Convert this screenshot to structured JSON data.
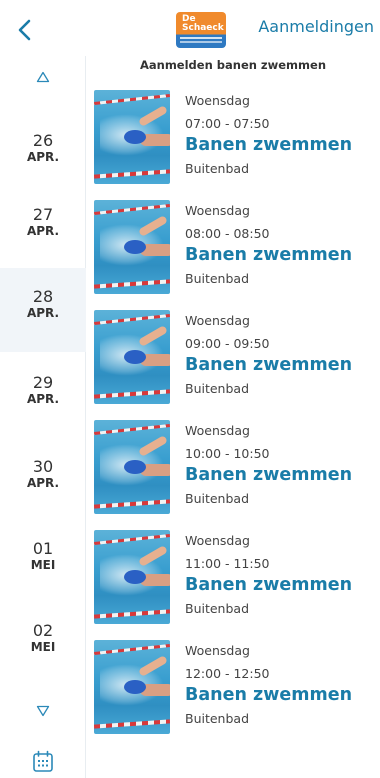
{
  "header": {
    "logo_line1": "De",
    "logo_line2": "Schaeck",
    "registrations_label": "Aanmeldingen"
  },
  "sidebar": {
    "days": [
      {
        "num": "26",
        "month": "APR.",
        "selected": false
      },
      {
        "num": "27",
        "month": "APR.",
        "selected": false
      },
      {
        "num": "28",
        "month": "APR.",
        "selected": true
      },
      {
        "num": "29",
        "month": "APR.",
        "selected": false
      },
      {
        "num": "30",
        "month": "APR.",
        "selected": false
      },
      {
        "num": "01",
        "month": "MEI",
        "selected": false
      },
      {
        "num": "02",
        "month": "MEI",
        "selected": false
      }
    ]
  },
  "list": {
    "title": "Aanmelden banen zwemmen",
    "items": [
      {
        "day": "Woensdag",
        "time": "07:00 - 07:50",
        "activity": "Banen zwemmen",
        "location": "Buitenbad"
      },
      {
        "day": "Woensdag",
        "time": "08:00 - 08:50",
        "activity": "Banen zwemmen",
        "location": "Buitenbad"
      },
      {
        "day": "Woensdag",
        "time": "09:00 - 09:50",
        "activity": "Banen zwemmen",
        "location": "Buitenbad"
      },
      {
        "day": "Woensdag",
        "time": "10:00 - 10:50",
        "activity": "Banen zwemmen",
        "location": "Buitenbad"
      },
      {
        "day": "Woensdag",
        "time": "11:00 - 11:50",
        "activity": "Banen zwemmen",
        "location": "Buitenbad"
      },
      {
        "day": "Woensdag",
        "time": "12:00 - 12:50",
        "activity": "Banen zwemmen",
        "location": "Buitenbad"
      }
    ]
  },
  "colors": {
    "accent": "#1a7ca8",
    "selected_day_bg": "#f1f5f9"
  }
}
